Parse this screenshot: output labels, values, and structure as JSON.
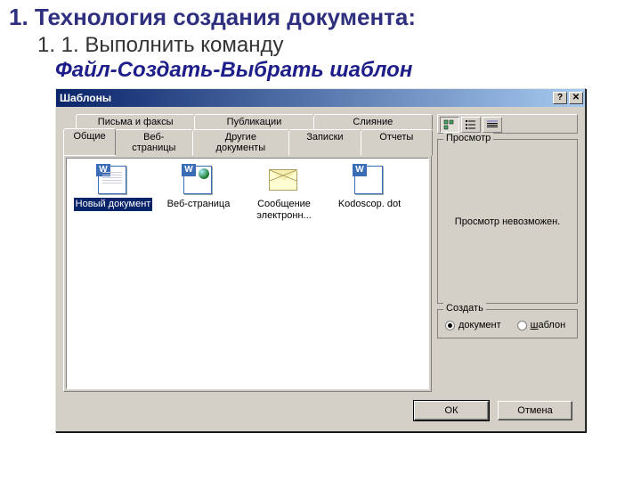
{
  "slide": {
    "heading1": "1. Технология создания документа:",
    "heading2": "1. 1.  Выполнить команду",
    "heading3": "Файл-Создать-Выбрать шаблон"
  },
  "dialog": {
    "title": "Шаблоны",
    "tabs_back": [
      "Письма и факсы",
      "Публикации",
      "Слияние"
    ],
    "tabs_front": [
      "Общие",
      "Веб-страницы",
      "Другие документы",
      "Записки",
      "Отчеты"
    ],
    "active_tab": "Общие",
    "items": [
      {
        "label": "Новый документ",
        "icon": "doc",
        "selected": true
      },
      {
        "label": "Веб-страница",
        "icon": "web",
        "selected": false
      },
      {
        "label": "Сообщение электронн...",
        "icon": "mail",
        "selected": false
      },
      {
        "label": "Kodoscop. dot",
        "icon": "doc",
        "selected": false
      }
    ],
    "preview": {
      "legend": "Просмотр",
      "msg": "Просмотр невозможен."
    },
    "create": {
      "legend": "Создать",
      "opt_document": "документ",
      "opt_template": "шаблон",
      "selected": "document"
    },
    "buttons": {
      "ok": "ОК",
      "cancel": "Отмена"
    }
  }
}
